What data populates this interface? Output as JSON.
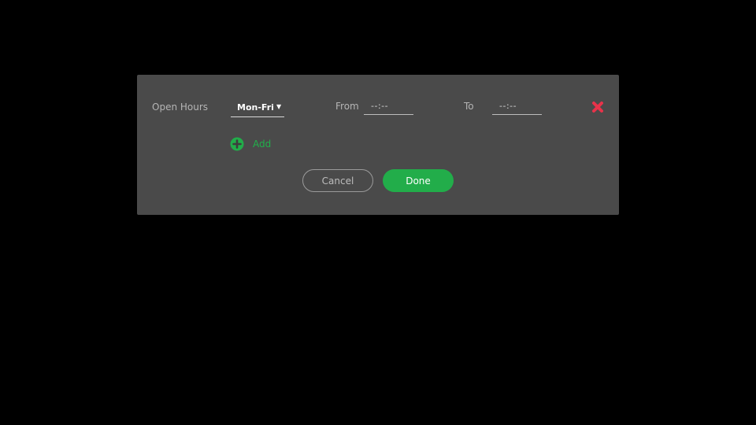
{
  "dialog": {
    "row_label": "Open Hours",
    "day_select": {
      "value": "Mon-Fri"
    },
    "from_label": "From",
    "from_value": "--:--",
    "to_label": "To",
    "to_value": "--:--",
    "add_label": "Add",
    "cancel_label": "Cancel",
    "done_label": "Done"
  },
  "icons": {
    "remove": "close-icon",
    "add": "plus-circle-icon",
    "caret": "caret-down-icon"
  },
  "colors": {
    "accent_green": "#22ad4a",
    "remove_red": "#e8334a",
    "dialog_bg": "#4a4a4a"
  }
}
